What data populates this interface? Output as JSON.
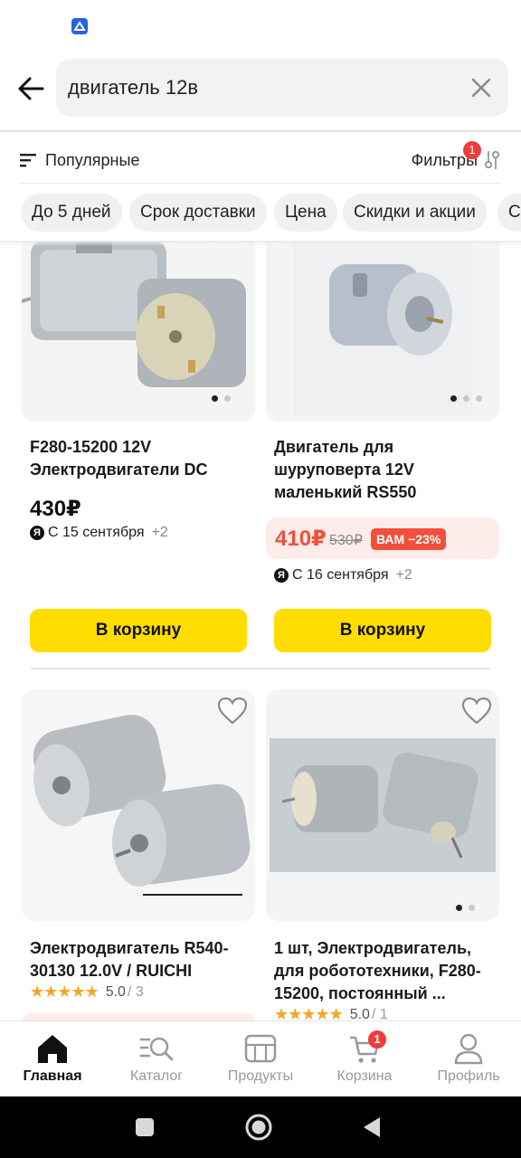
{
  "search": {
    "query": "двигатель 12в"
  },
  "toolbar": {
    "sort_label": "Популярные",
    "filters_label": "Фильтры",
    "filters_badge": "1"
  },
  "chips": [
    "До 5 дней",
    "Срок доставки",
    "Цена",
    "Скидки и акции",
    "Со"
  ],
  "products": [
    {
      "title": "F280-15200 12V Электродвигатели DC",
      "price": "430₽",
      "delivery": "С 15 сентября",
      "delivery_extra": "+2",
      "cart_label": "В корзину"
    },
    {
      "title": "Двигатель для шуруповерта 12V маленький RS550",
      "sale_price": "410₽",
      "old_price": "530₽",
      "discount": "ВАМ −23%",
      "delivery": "С 16 сентября",
      "delivery_extra": "+2",
      "cart_label": "В корзину"
    },
    {
      "title": "Электродвигатель R540-30130 12.0V / RUICHI",
      "rating": "5.0",
      "rating_count": "/ 3"
    },
    {
      "title": "1 шт, Электродвигатель, для робототехники, F280-15200, постоянный ...",
      "rating": "5.0",
      "rating_count": "/ 1"
    }
  ],
  "ya_logo": "Я",
  "stars": "★★★★★",
  "bottom_nav": [
    {
      "label": "Главная",
      "icon": "home-icon",
      "active": true
    },
    {
      "label": "Каталог",
      "icon": "catalog-search-icon"
    },
    {
      "label": "Продукты",
      "icon": "grocery-basket-icon"
    },
    {
      "label": "Корзина",
      "icon": "cart-icon",
      "badge": "1"
    },
    {
      "label": "Профиль",
      "icon": "profile-icon"
    }
  ],
  "colors": {
    "accent_yellow": "#ffdd00",
    "sale_red": "#f2503a",
    "badge_red": "#f03c3c",
    "star": "#f5a623"
  }
}
